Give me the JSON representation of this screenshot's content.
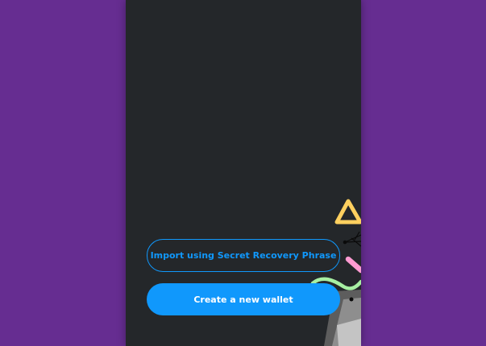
{
  "onboarding": {
    "import_label": "Import using Secret Recovery Phrase",
    "create_label": "Create a new wallet"
  },
  "colors": {
    "background": "#662d91",
    "panel": "#24272a",
    "accent": "#1098fc"
  }
}
